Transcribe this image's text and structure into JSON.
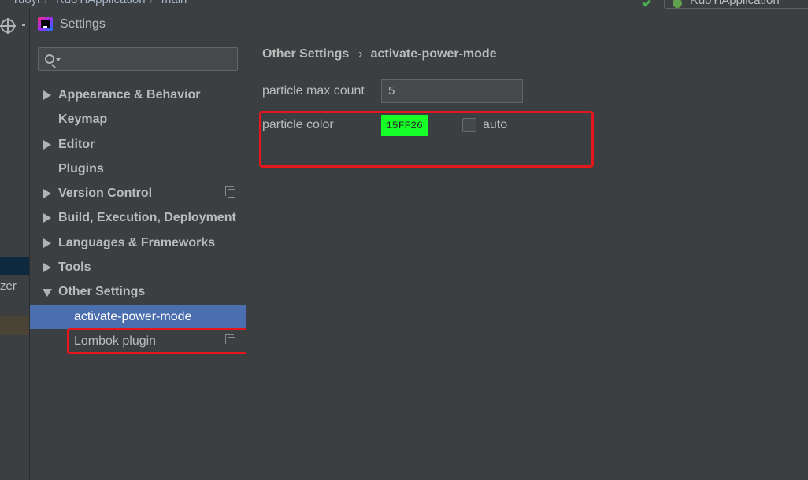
{
  "ide": {
    "breadcrumbs": [
      "ruoyi",
      "RuoYiApplication",
      "main"
    ],
    "run_config": "RuoYiApplication",
    "left_panel_fragment": "zer"
  },
  "dialog": {
    "title": "Settings"
  },
  "sidebar": {
    "search": {
      "value": "",
      "placeholder": ""
    },
    "items": [
      {
        "label": "Appearance & Behavior",
        "expandable": true,
        "expanded": false
      },
      {
        "label": "Keymap",
        "expandable": false
      },
      {
        "label": "Editor",
        "expandable": true,
        "expanded": false
      },
      {
        "label": "Plugins",
        "expandable": false
      },
      {
        "label": "Version Control",
        "expandable": true,
        "expanded": false,
        "project_icon": "copy-icon"
      },
      {
        "label": "Build, Execution, Deployment",
        "expandable": true,
        "expanded": false
      },
      {
        "label": "Languages & Frameworks",
        "expandable": true,
        "expanded": false
      },
      {
        "label": "Tools",
        "expandable": true,
        "expanded": false
      },
      {
        "label": "Other Settings",
        "expandable": true,
        "expanded": true
      },
      {
        "label": "activate-power-mode",
        "child": true,
        "selected": true
      },
      {
        "label": "Lombok plugin",
        "child": true,
        "project_icon": "copy-icon"
      }
    ]
  },
  "main": {
    "breadcrumb": [
      "Other Settings",
      "activate-power-mode"
    ],
    "breadcrumb_separator": "›",
    "particle_max_count": {
      "label": "particle max count",
      "value": "5"
    },
    "particle_color": {
      "label": "particle color",
      "value": "15FF26",
      "hex": "#15ff26"
    },
    "auto": {
      "label": "auto",
      "checked": false
    }
  },
  "colors": {
    "background": "#3c3f41",
    "selection": "#4b6eaf",
    "highlight": "#e5171c",
    "text": "#bbbbbb"
  }
}
